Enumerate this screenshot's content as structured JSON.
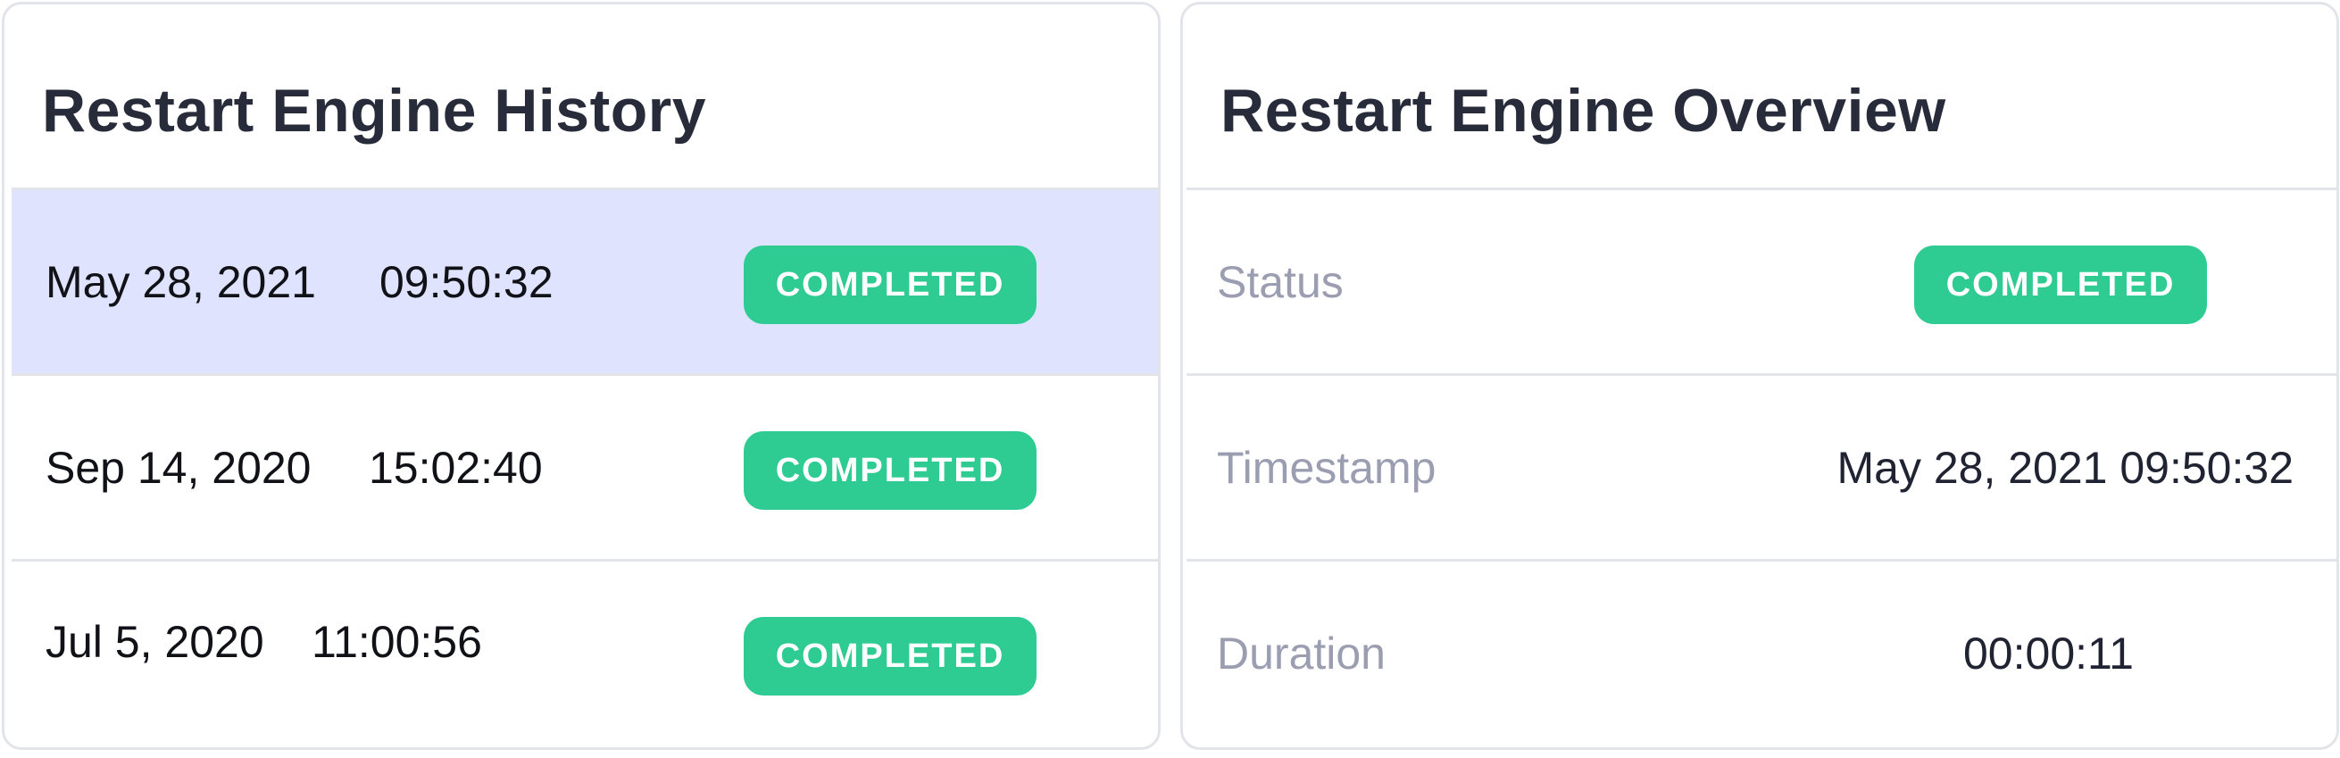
{
  "history": {
    "title": "Restart Engine History",
    "rows": [
      {
        "date": "May 28, 2021",
        "time": "09:50:32",
        "status": "COMPLETED",
        "selected": true
      },
      {
        "date": "Sep 14, 2020",
        "time": "15:02:40",
        "status": "COMPLETED",
        "selected": false
      },
      {
        "date": "Jul 5, 2020",
        "time": "11:00:56",
        "status": "COMPLETED",
        "selected": false
      }
    ]
  },
  "overview": {
    "title": "Restart Engine Overview",
    "status_label": "Status",
    "status_value": "COMPLETED",
    "timestamp_label": "Timestamp",
    "timestamp_value": "May 28, 2021 09:50:32",
    "duration_label": "Duration",
    "duration_value": "00:00:11"
  },
  "colors": {
    "badge_green": "#2ecb92",
    "selected_row": "#e0e3fd",
    "border": "#e3e4ea",
    "title_text": "#272b3a",
    "muted_label": "#9b9eb0"
  }
}
